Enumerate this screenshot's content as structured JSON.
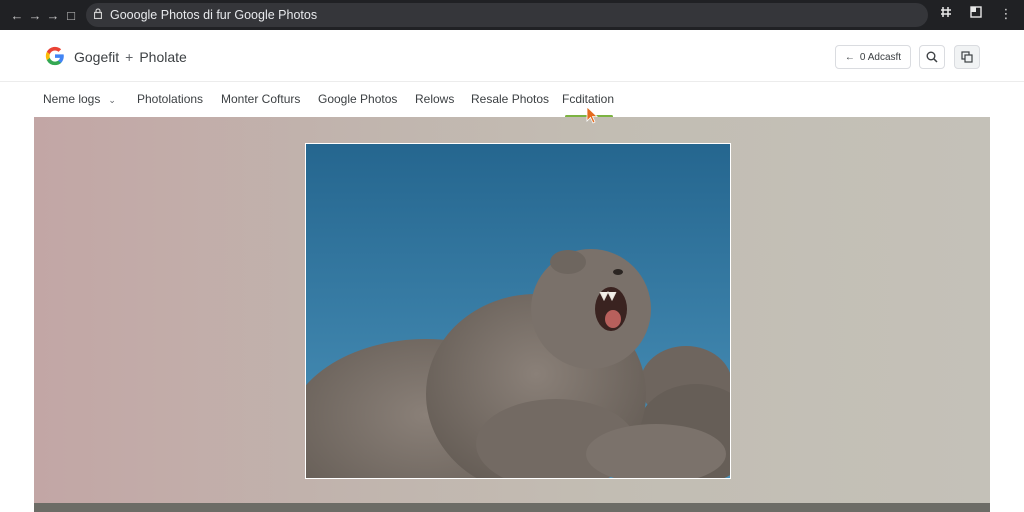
{
  "browser": {
    "url": "Gooogle Photos di fur Google Photos",
    "icons": {
      "back": "back-arrow-icon",
      "forward": "forward-arrow-icon",
      "forward2": "forward-arrow-icon",
      "home": "home-icon",
      "lock": "lock-icon",
      "extensions": "grid-icon",
      "tab": "tab-icon",
      "menu": "kebab-menu-icon"
    }
  },
  "header": {
    "brand": "Gogefit",
    "separator": "+",
    "subtitle": "Pholate",
    "action_button": "0 Adcasft",
    "icons": {
      "logo": "google-g-logo",
      "search": "search-icon",
      "copy": "copy-icon"
    }
  },
  "tabs": [
    {
      "label": "Neme logs",
      "has_dropdown": true
    },
    {
      "label": "Photolations"
    },
    {
      "label": "Monter Cofturs"
    },
    {
      "label": "Google Photos"
    },
    {
      "label": "Relows"
    },
    {
      "label": "Resale Photos"
    },
    {
      "label": "Fcditation",
      "active": true
    }
  ],
  "colors": {
    "chrome_bg": "#202124",
    "omnibox_bg": "#35363a",
    "active_tab_underline": "#7cb342",
    "sky_blue": "#2c6f9c",
    "fur_gray": "#7a716a"
  },
  "photo": {
    "subject": "fluffy gray animal against blue sky"
  }
}
